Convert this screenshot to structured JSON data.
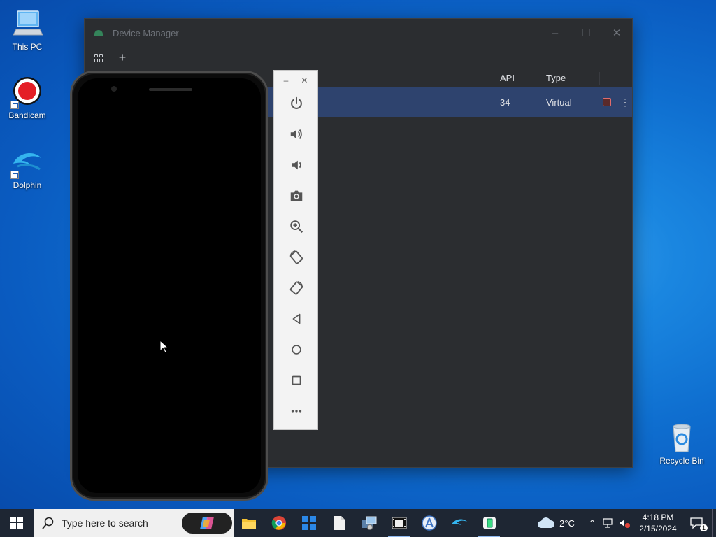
{
  "desktop": {
    "icons": [
      {
        "label": "This PC"
      },
      {
        "label": "Bandicam"
      },
      {
        "label": "Dolphin"
      },
      {
        "label": "Recycle Bin"
      }
    ]
  },
  "device_manager": {
    "title": "Device Manager",
    "columns": {
      "api": "API",
      "type": "Type"
    },
    "devices": [
      {
        "api": "34",
        "type": "Virtual",
        "status": "running"
      }
    ]
  },
  "emulator_toolbar": {
    "buttons": [
      "power",
      "volume-up",
      "volume-down",
      "screenshot",
      "zoom",
      "rotate-left",
      "rotate-right",
      "back",
      "home",
      "overview",
      "more"
    ]
  },
  "taskbar": {
    "search_placeholder": "Type here to search",
    "weather": "2°C",
    "time": "4:18 PM",
    "date": "2/15/2024",
    "notification_count": "1"
  },
  "colors": {
    "accent": "#2e436e",
    "android_green": "#3ddc84",
    "stop_red": "#e06c6c"
  }
}
